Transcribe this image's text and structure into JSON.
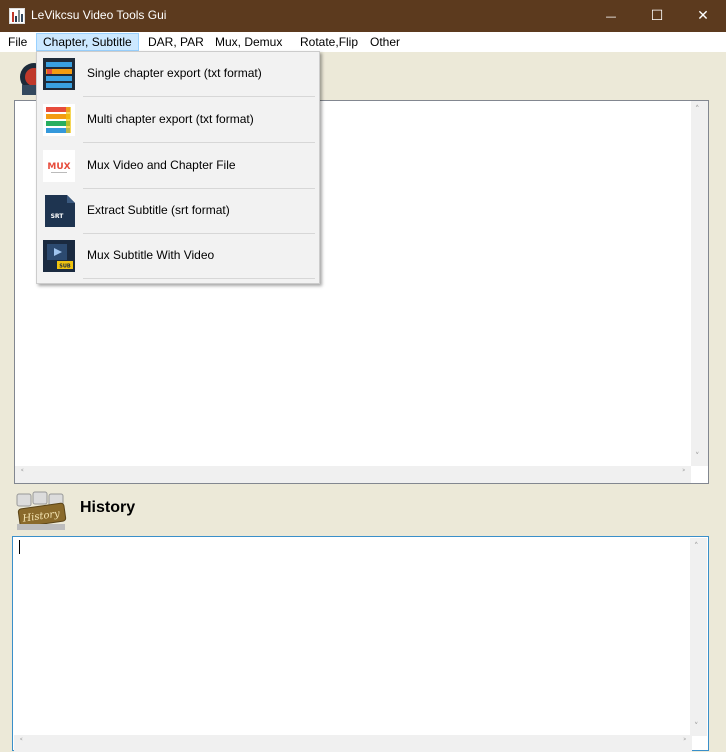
{
  "window": {
    "title": "LeVikcsu Video Tools Gui",
    "minimize_glyph": "—",
    "maximize_glyph": "☐",
    "close_glyph": "✕",
    "titlebar_color": "#5c3a1e"
  },
  "menubar": {
    "items": [
      "File",
      "Chapter, Subtitle",
      "DAR, PAR",
      "Mux, Demux",
      "Rotate,Flip",
      "Other"
    ],
    "active_index": 1
  },
  "dropdown": {
    "items": [
      {
        "label": "Single chapter export (txt format)",
        "icon": "single-chapter-icon"
      },
      {
        "label": "Multi chapter export (txt format)",
        "icon": "multi-chapter-icon"
      },
      {
        "label": "Mux Video and Chapter File",
        "icon": "mux-icon",
        "icon_text": "MUX"
      },
      {
        "label": "Extract Subtitle (srt format)",
        "icon": "srt-file-icon",
        "icon_text": "SRT"
      },
      {
        "label": "Mux Subtitle With Video",
        "icon": "sub-video-icon",
        "icon_text": "SUB"
      }
    ]
  },
  "history": {
    "label": "History",
    "icon_text": "History"
  },
  "scroll": {
    "up": "˄",
    "down": "˅",
    "left": "˂",
    "right": "˃"
  }
}
